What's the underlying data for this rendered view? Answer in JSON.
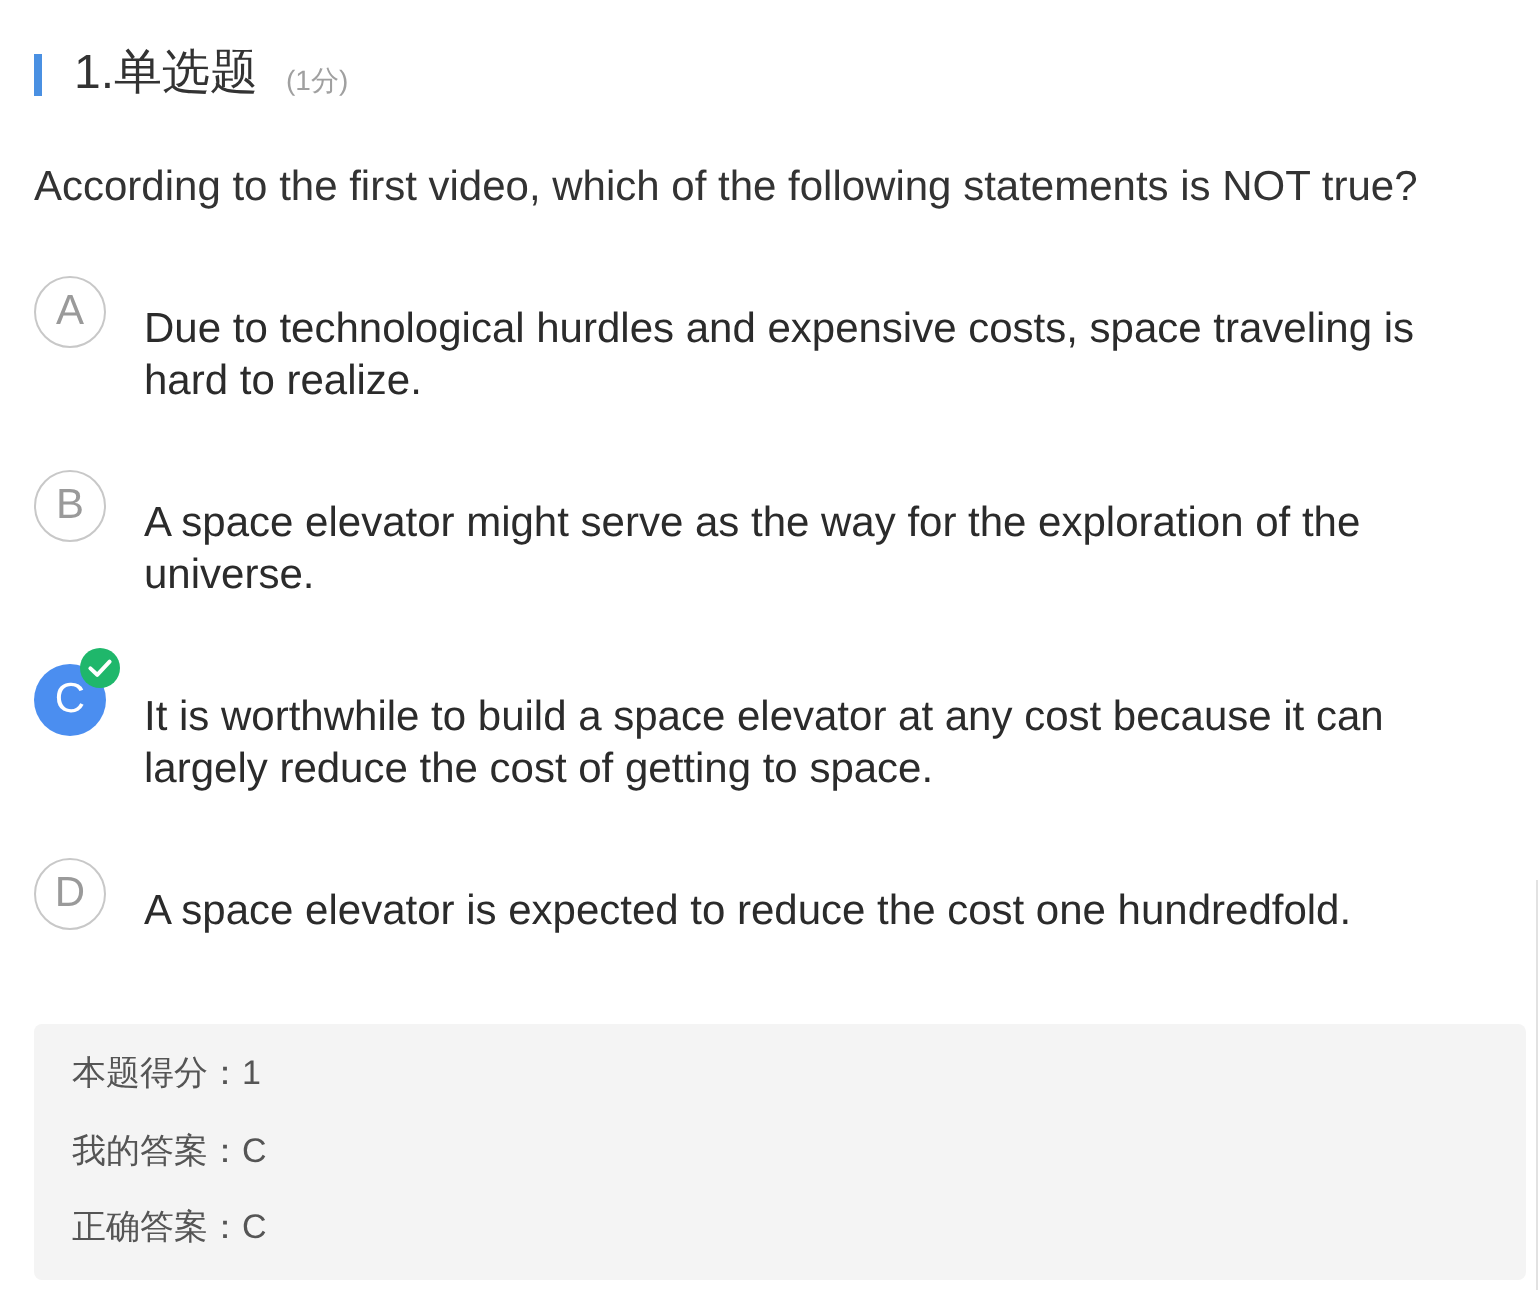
{
  "header": {
    "title": "1.单选题",
    "score": "(1分)"
  },
  "question": "According to the first video, which of the following statements is NOT true?",
  "options": [
    {
      "letter": "A",
      "text": "Due to technological hurdles and expensive costs, space traveling is hard to realize.",
      "selected": false,
      "correct": false
    },
    {
      "letter": "B",
      "text": "A space elevator might serve as the way for the exploration of the universe.",
      "selected": false,
      "correct": false
    },
    {
      "letter": "C",
      "text": "It is worthwhile to build a space elevator at any cost because it can largely reduce the cost of getting to space.",
      "selected": true,
      "correct": true
    },
    {
      "letter": "D",
      "text": "A space elevator is expected to reduce the cost one hundredfold.",
      "selected": false,
      "correct": false
    }
  ],
  "result": [
    "本题得分：1",
    "我的答案：C",
    "正确答案：C"
  ]
}
